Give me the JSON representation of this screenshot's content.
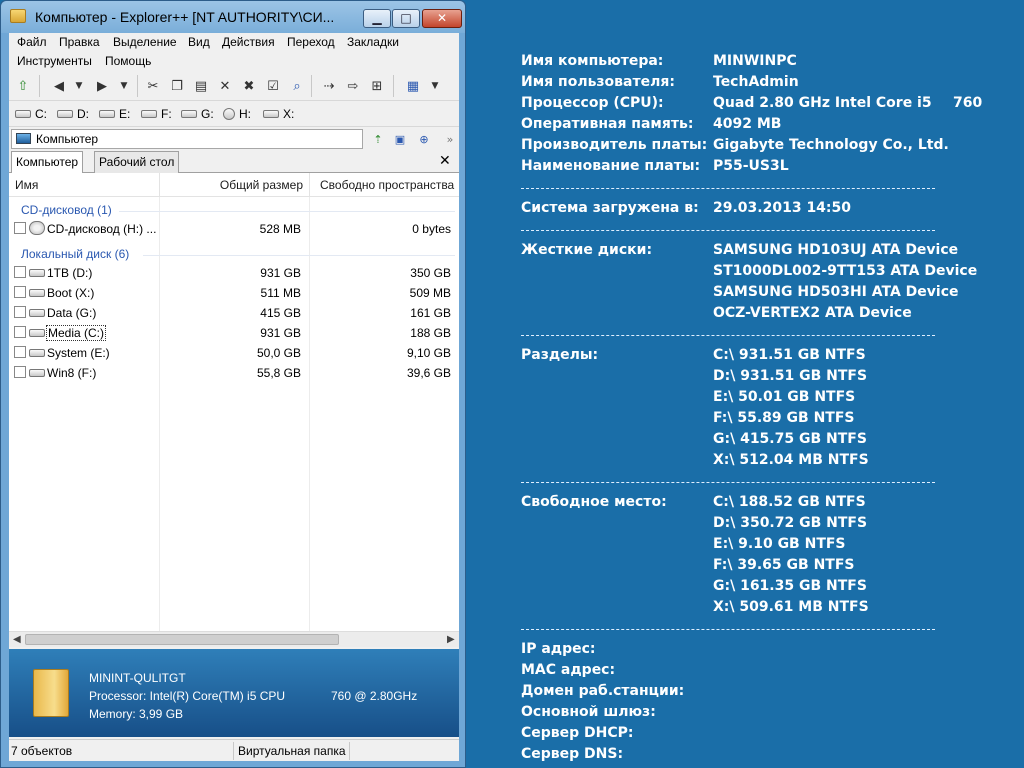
{
  "window": {
    "title": "Компьютер - Explorer++ [NT AUTHORITY\\СИ...",
    "min_glyph": "▁",
    "max_glyph": "□",
    "close_glyph": "✕"
  },
  "menu": [
    "Файл",
    "Правка",
    "Выделение",
    "Вид",
    "Действия",
    "Переход",
    "Закладки",
    "Инструменты",
    "Помощь"
  ],
  "toolbar_icons": [
    "up-folder-icon",
    "back-icon",
    "dropdown-icon",
    "forward-icon",
    "dropdown-icon",
    "cut-icon",
    "copy-icon",
    "paste-icon",
    "delete-icon",
    "delete-permanent-icon",
    "properties-icon",
    "search-icon",
    "copy-to-icon",
    "move-to-icon",
    "new-folder-icon",
    "views-icon",
    "dropdown-icon"
  ],
  "drives": [
    "C:",
    "D:",
    "E:",
    "F:",
    "G:",
    "H:",
    "X:"
  ],
  "address": {
    "value": "Компьютер"
  },
  "tabs": {
    "items": [
      "Компьютер",
      "Рабочий стол"
    ],
    "close": "✕"
  },
  "listview": {
    "columns": [
      "Имя",
      "Общий размер",
      "Свободно пространства"
    ],
    "groups": [
      {
        "label": "CD-дисковод (1)",
        "rows": [
          {
            "name": "CD-дисковод (H:) ...",
            "size": "528 MB",
            "free": "0 bytes"
          }
        ]
      },
      {
        "label": "Локальный диск (6)",
        "rows": [
          {
            "name": "1TB (D:)",
            "size": "931 GB",
            "free": "350 GB"
          },
          {
            "name": "Boot (X:)",
            "size": "511 MB",
            "free": "509 MB"
          },
          {
            "name": "Data (G:)",
            "size": "415 GB",
            "free": "161 GB"
          },
          {
            "name": "Media (C:)",
            "size": "931 GB",
            "free": "188 GB"
          },
          {
            "name": "System (E:)",
            "size": "50,0 GB",
            "free": "9,10 GB"
          },
          {
            "name": "Win8 (F:)",
            "size": "55,8 GB",
            "free": "39,6 GB"
          }
        ]
      }
    ]
  },
  "details": {
    "name": "MININT-QULITGT",
    "processor": "Processor: Intel(R) Core(TM) i5 CPU",
    "processor_model": "760  @ 2.80GHz",
    "memory": "Memory: 3,99 GB"
  },
  "status": {
    "count": "7 объектов",
    "type": "Виртуальная папка"
  },
  "bginfo": {
    "hostname_label": "Имя компьютера:",
    "hostname": "MINWINPC",
    "user_label": "Имя пользователя:",
    "user": "TechAdmin",
    "cpu_label": "Процессор (CPU):",
    "cpu": "Quad 2.80 GHz Intel Core i5",
    "cpu_model": "760",
    "ram_label": "Оперативная память:",
    "ram": "4092 MB",
    "board_vendor_label": "Производитель платы:",
    "board_vendor": "Gigabyte Technology Co., Ltd.",
    "board_name_label": "Наименование платы:",
    "board_name": "P55-US3L",
    "separator": "------------------------------------------------------------------------",
    "boot_label": "Система загружена в:",
    "boot": "29.03.2013 14:50",
    "disks_label": "Жесткие диски:",
    "disks": [
      "SAMSUNG HD103UJ ATA Device",
      "ST1000DL002-9TT153 ATA Device",
      "SAMSUNG HD503HI ATA Device",
      "OCZ-VERTEX2 ATA Device"
    ],
    "partitions_label": "Разделы:",
    "partitions": [
      "C:\\ 931.51 GB NTFS",
      "D:\\ 931.51 GB NTFS",
      "E:\\ 50.01 GB NTFS",
      "F:\\ 55.89 GB NTFS",
      "G:\\ 415.75 GB NTFS",
      "X:\\ 512.04 MB NTFS"
    ],
    "free_label": "Свободное место:",
    "free": [
      "C:\\ 188.52 GB NTFS",
      "D:\\ 350.72 GB NTFS",
      "E:\\ 9.10 GB NTFS",
      "F:\\ 39.65 GB NTFS",
      "G:\\ 161.35 GB NTFS",
      "X:\\ 509.61 MB NTFS"
    ],
    "ip_label": "IP адрес:",
    "mac_label": "MAC адрес:",
    "domain_label": "Домен раб.станции:",
    "gateway_label": "Основной шлюз:",
    "dhcp_label": "Сервер DHCP:",
    "dns_label": "Сервер DNS:"
  }
}
